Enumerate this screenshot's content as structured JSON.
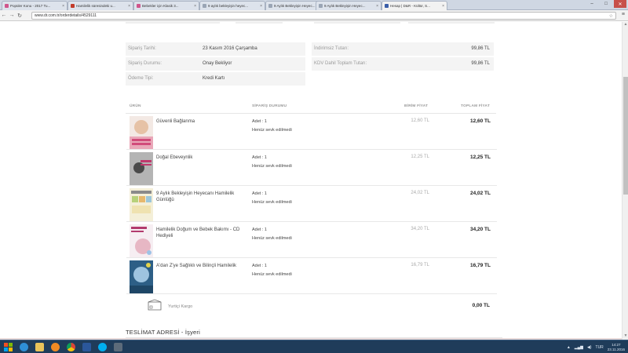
{
  "browser": {
    "tabs": [
      {
        "title": "Popüler Konu - 2017 Tu...",
        "fav": "#d0568c"
      },
      {
        "title": "Hamilelik süresindeki u...",
        "fav": "#c23b2a"
      },
      {
        "title": "Bebekler için Klasik 3...",
        "fav": "#d0568c"
      },
      {
        "title": "9 aylık bekleyişin heyec...",
        "fav": "#9aa5b5"
      },
      {
        "title": "9 Aylık Bekleyişin Heyec...",
        "fav": "#9aa5b5"
      },
      {
        "title": "9 Aylık Bekleyişin Heyec...",
        "fav": "#9aa5b5"
      },
      {
        "title": "Hesap | D&R - Kültür, S...",
        "fav": "#3a5ea8"
      }
    ],
    "url": "www.dr.com.tr/orderdetails/4529111",
    "window_controls": {
      "minimize": "–",
      "maximize": "□",
      "close": "✕"
    }
  },
  "order_info": {
    "left": [
      {
        "label": "Sipariş Tarihi:",
        "value": "23 Kasım 2016 Çarşamba"
      },
      {
        "label": "Sipariş Durumu:",
        "value": "Onay Bekliyor"
      },
      {
        "label": "Ödeme Tipi:",
        "value": "Kredi Kartı"
      }
    ],
    "right": [
      {
        "label": "İndirimsiz Tutarı:",
        "value": "99,86 TL"
      },
      {
        "label": "KDV Dahil Toplam Tutarı:",
        "value": "99,86 TL"
      }
    ]
  },
  "table": {
    "headers": {
      "product": "ÜRÜN",
      "status": "SİPARİŞ DURUMU",
      "unit_price": "BİRİM FİYAT",
      "total_price": "TOPLAM FİYAT"
    },
    "rows": [
      {
        "name": "Güvenli Bağlanma",
        "qty": "Adet : 1",
        "status": "Henüz sevk edilmedi",
        "unit": "12,60 TL",
        "total": "12,60 TL",
        "cover": "cover-1"
      },
      {
        "name": "Doğal Ebeveynlik",
        "qty": "Adet : 1",
        "status": "Henüz sevk edilmedi",
        "unit": "12,25 TL",
        "total": "12,25 TL",
        "cover": "cover-2"
      },
      {
        "name": "9 Aylık Bekleyişin Heyecanı Hamilelik Günlüğü",
        "qty": "Adet : 1",
        "status": "Henüz sevk edilmedi",
        "unit": "24,02 TL",
        "total": "24,02 TL",
        "cover": "cover-3"
      },
      {
        "name": "Hamilelik Doğum ve Bebek Bakımı - CD Hediyeli",
        "qty": "Adet : 1",
        "status": "Henüz sevk edilmedi",
        "unit": "34,20 TL",
        "total": "34,20 TL",
        "cover": "cover-4"
      },
      {
        "name": "A'dan Z'ye Sağlıklı ve Bilinçli Hamilelik",
        "qty": "Adet : 1",
        "status": "Henüz sevk edilmedi",
        "unit": "16,79 TL",
        "total": "16,79 TL",
        "cover": "cover-5"
      }
    ]
  },
  "cargo": {
    "label": "Yurtiçi Kargo",
    "total": "0,00 TL",
    "icon": "cargo-box-icon"
  },
  "delivery": {
    "title": "TESLİMAT ADRESİ - İşyeri"
  },
  "taskbar": {
    "icons": [
      "ie-icon",
      "folder-icon",
      "media-player-icon",
      "chrome-icon",
      "word-icon",
      "skype-icon",
      "mail-icon"
    ],
    "tray": {
      "lang": "TUR",
      "time": "14:27",
      "date": "23.11.2016"
    }
  }
}
